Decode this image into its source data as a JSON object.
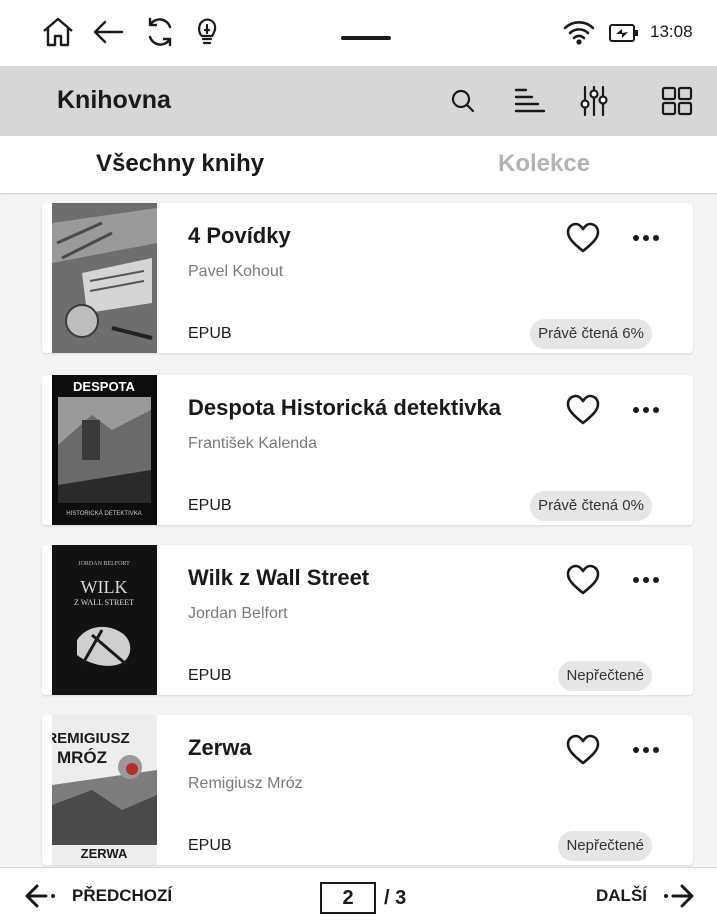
{
  "status_bar": {
    "time": "13:08"
  },
  "app_bar": {
    "title": "Knihovna"
  },
  "tabs": {
    "all": "Všechny knihy",
    "collections": "Kolekce"
  },
  "books": [
    {
      "title": "4 Povídky",
      "author": "Pavel Kohout",
      "format": "EPUB",
      "status": "Právě čtená 6%"
    },
    {
      "title": "Despota Historická detektivka",
      "author": "František Kalenda",
      "format": "EPUB",
      "status": "Právě čtená 0%",
      "cover_title": "DESPOTA",
      "cover_subtitle": "HISTORICKÁ DETEKTIVKA"
    },
    {
      "title": "Wilk z Wall Street",
      "author": "Jordan Belfort",
      "format": "EPUB",
      "status": "Nepřečtené",
      "cover_author": "JORDAN BELFORT",
      "cover_title": "WILK",
      "cover_subtitle": "Z WALL STREET"
    },
    {
      "title": "Zerwa",
      "author": "Remigiusz Mróz",
      "format": "EPUB",
      "status": "Nepřečtené",
      "cover_author_line1": "REMIGIUSZ",
      "cover_author_line2": "MRÓZ",
      "cover_title": "ZERWA"
    }
  ],
  "pagination": {
    "prev_label": "PŘEDCHOZÍ",
    "current_page": "2",
    "total": "/ 3",
    "next_label": "DALŠÍ"
  }
}
